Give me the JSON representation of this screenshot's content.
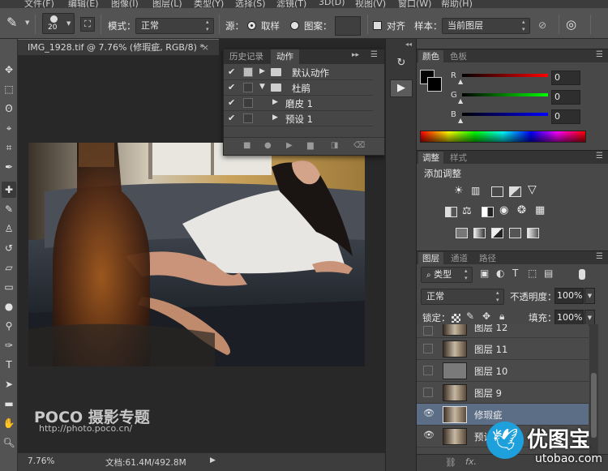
{
  "menubar": {
    "items": [
      "文件(F)",
      "编辑(E)",
      "图像(I)",
      "图层(L)",
      "类型(Y)",
      "选择(S)",
      "滤镜(T)",
      "3D(D)",
      "视图(V)",
      "窗口(W)",
      "帮助(H)"
    ]
  },
  "options": {
    "brush_size": "20",
    "mode_label": "模式：",
    "mode_value": "正常",
    "source_label": "源：",
    "sampled_label": "取样",
    "pattern_label": "图案：",
    "aligned_label": "对齐",
    "sample_label": "样本：",
    "sample_value": "当前图层"
  },
  "document": {
    "tab_title": "IMG_1928.tif @ 7.76% (修瑕疵, RGB/8) *",
    "zoom": "7.76%",
    "doc_size": "文档:61.4M/492.8M"
  },
  "actions_panel": {
    "tabs": [
      "历史记录",
      "动作"
    ],
    "rows": [
      {
        "label": "默认动作"
      },
      {
        "label": "杜鹃"
      },
      {
        "label": "磨皮 1"
      },
      {
        "label": "预设 1"
      }
    ]
  },
  "color_panel": {
    "tabs": [
      "颜色",
      "色板"
    ],
    "r_label": "R",
    "g_label": "G",
    "b_label": "B",
    "r": "0",
    "g": "0",
    "b": "0"
  },
  "adjust_panel": {
    "tabs": [
      "调整",
      "样式"
    ],
    "add_label": "添加调整"
  },
  "layers_panel": {
    "tabs": [
      "图层",
      "通道",
      "路径"
    ],
    "filter_label": "类型",
    "blend_mode": "正常",
    "opacity_label": "不透明度：",
    "opacity": "100%",
    "lock_label": "锁定：",
    "fill_label": "填充：",
    "fill": "100%",
    "layers": [
      {
        "name": "图层 12",
        "visible": false
      },
      {
        "name": "图层 11",
        "visible": false
      },
      {
        "name": "图层 10",
        "visible": false
      },
      {
        "name": "图层 9",
        "visible": false
      },
      {
        "name": "修瑕疵",
        "visible": true,
        "selected": true
      },
      {
        "name": "预设",
        "visible": true
      }
    ]
  },
  "watermarks": {
    "poco": "POCO 摄影专题",
    "poco_url": "http://photo.poco.cn/",
    "uibao": "优图宝",
    "uibao_url": "utobao.com"
  },
  "colors": {
    "selected_layer": "#5b6e86",
    "panel": "#484848",
    "background": "#282828"
  }
}
